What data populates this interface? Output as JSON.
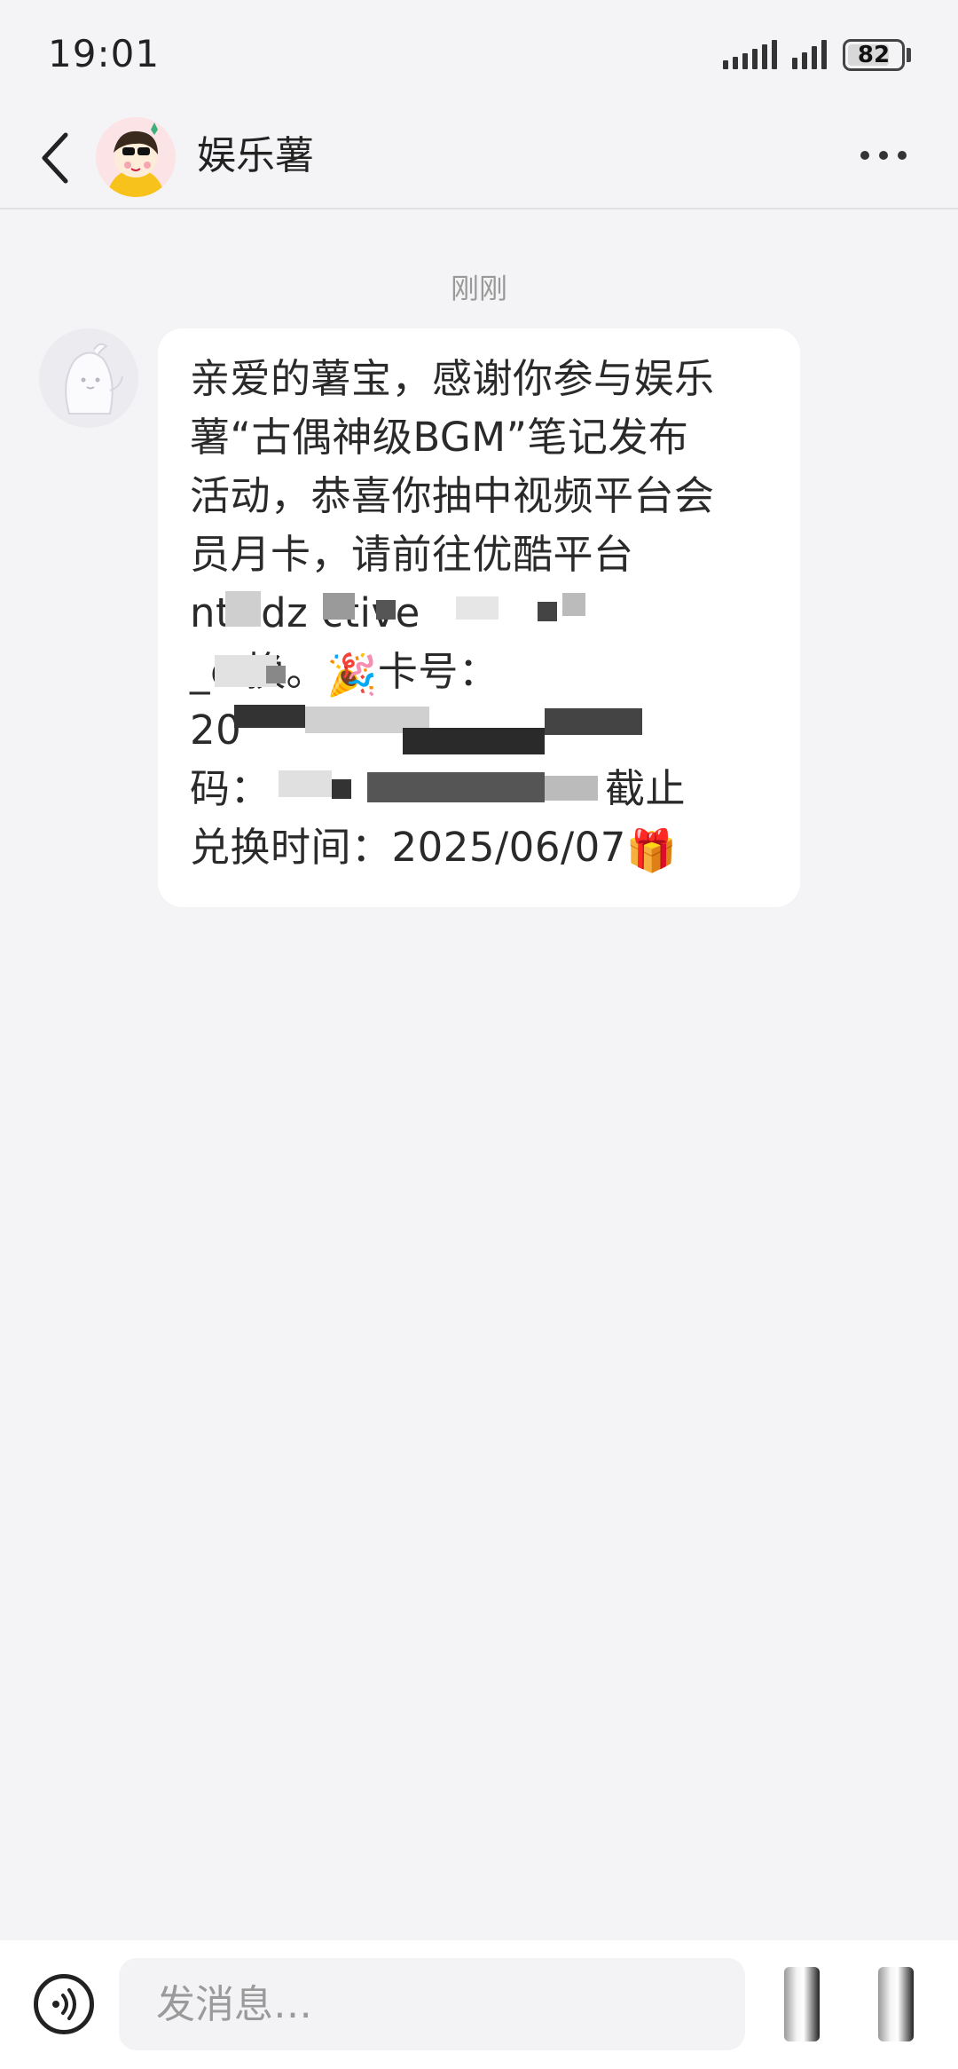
{
  "status_bar": {
    "time": "19:01",
    "battery": "82",
    "battery_level": 0.82
  },
  "header": {
    "title": "娱乐薯",
    "back_icon": "chevron-left-icon",
    "more_icon": "more-horizontal-icon"
  },
  "chat": {
    "timestamp": "刚刚",
    "message": {
      "lines": [
        "亲爱的薯宝，感谢你参与娱乐",
        "薯“古偶神级BGM”笔记发布",
        "活动，恭喜你抽中视频平台会",
        "员月卡，请前往优酷平台",
        "ntt     dz         ctive",
        "_c      换。",
        "卡号：",
        "20",
        "码：",
        "截止",
        "兑换时间：2025/06/07"
      ],
      "emoji_party": "🎉",
      "emoji_gift": "🎁"
    }
  },
  "input_bar": {
    "placeholder": "发消息…",
    "voice_icon": "voice-wave-icon"
  },
  "colors": {
    "background": "#f4f4f6",
    "bubble": "#ffffff",
    "timestamp": "#999999",
    "text": "#2a2a2a"
  }
}
